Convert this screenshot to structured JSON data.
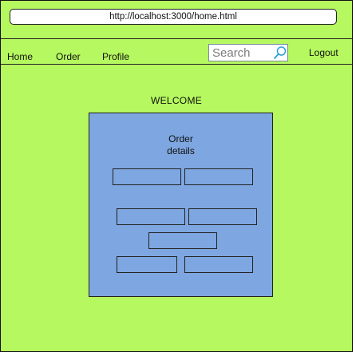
{
  "browser": {
    "url": "http://localhost:3000/home.html"
  },
  "nav": {
    "home": "Home",
    "order": "Order",
    "profile": "Profile",
    "logout": "Logout"
  },
  "search": {
    "placeholder": "Search",
    "icon": "search-icon"
  },
  "main": {
    "welcome": "WELCOME",
    "panel_title_line1": "Order",
    "panel_title_line2": "details"
  },
  "colors": {
    "page_background": "#b5f85f",
    "panel_background": "#7ea6e0",
    "search_icon": "#2a9fd6"
  }
}
